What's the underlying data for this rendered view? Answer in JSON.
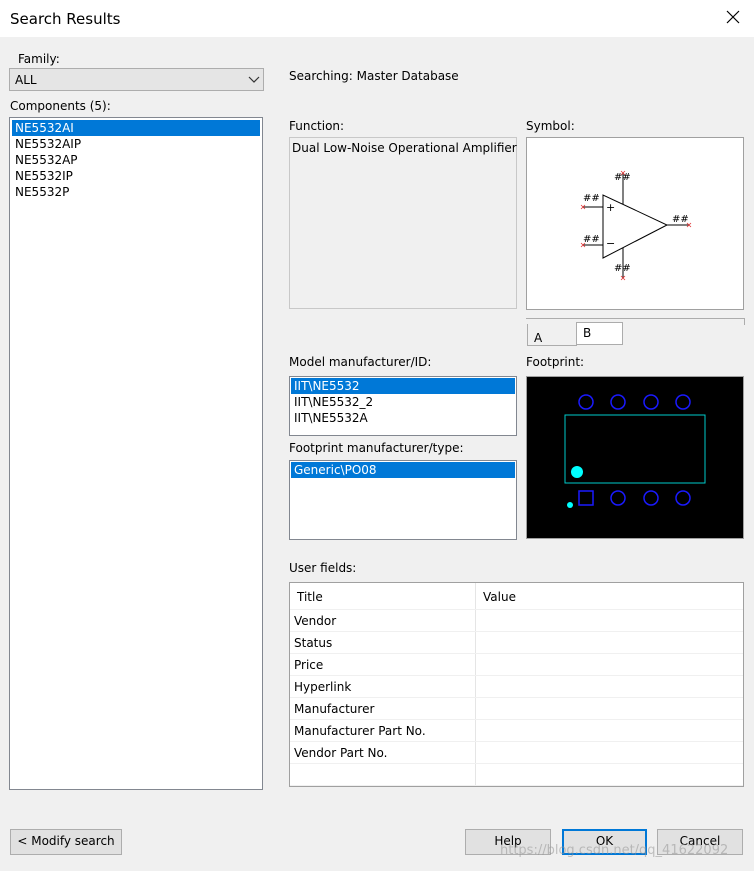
{
  "window": {
    "title": "Search Results"
  },
  "family": {
    "label": "Family:",
    "value": "ALL"
  },
  "components": {
    "label": "Components (5):",
    "items": [
      "NE5532AI",
      "NE5532AIP",
      "NE5532AP",
      "NE5532IP",
      "NE5532P"
    ],
    "selected_index": 0
  },
  "searching": "Searching: Master Database",
  "function": {
    "label": "Function:",
    "value": "Dual Low-Noise Operational Amplifier"
  },
  "symbol": {
    "label": "Symbol:",
    "pin_labels": [
      "##",
      "##",
      "##",
      "##",
      "##"
    ],
    "plus": "+",
    "minus": "−",
    "tabs": [
      "A",
      "B"
    ],
    "active_tab": "B"
  },
  "model": {
    "label": "Model manufacturer/ID:",
    "items": [
      "IIT\\NE5532",
      "IIT\\NE5532_2",
      "IIT\\NE5532A"
    ],
    "selected_index": 0
  },
  "footprint": {
    "label": "Footprint:",
    "pad_color": "#1a1aff",
    "outline_color": "#00cccc",
    "marker_color": "#00ffff"
  },
  "footprint_type": {
    "label": "Footprint manufacturer/type:",
    "items": [
      "Generic\\PO08"
    ],
    "selected_index": 0
  },
  "user_fields": {
    "label": "User fields:",
    "columns": [
      "Title",
      "Value"
    ],
    "rows": [
      "Vendor",
      "Status",
      "Price",
      "Hyperlink",
      "Manufacturer",
      "Manufacturer Part No.",
      "Vendor Part No."
    ]
  },
  "buttons": {
    "modify_search": "< Modify search",
    "help": "Help",
    "ok": "OK",
    "cancel": "Cancel"
  },
  "watermark": "https://blog.csdn.net/qq_41622092"
}
